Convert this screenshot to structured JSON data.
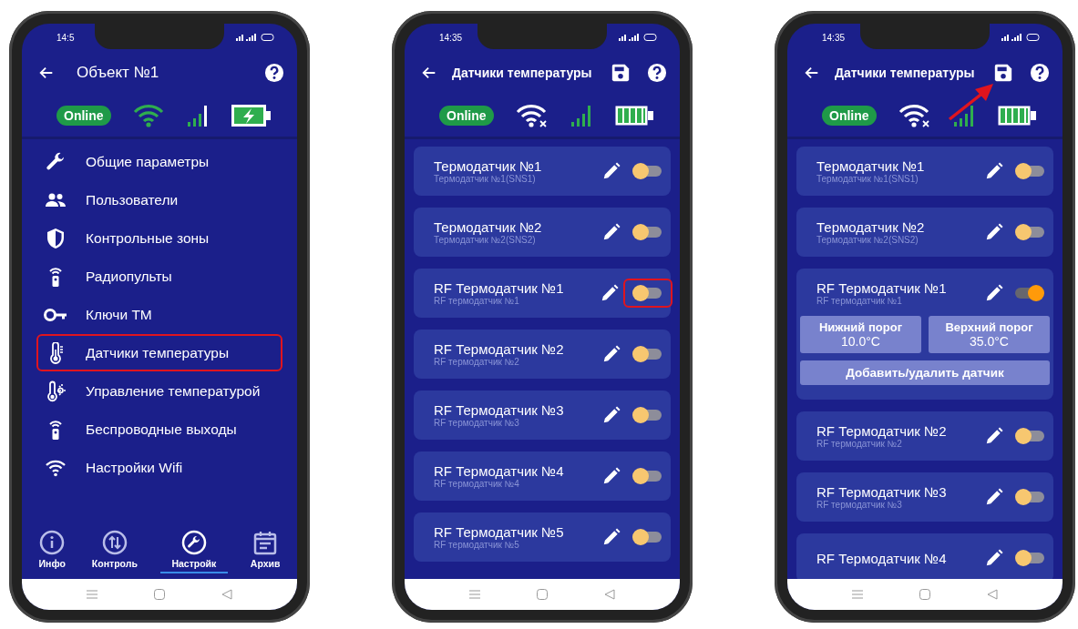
{
  "phones": [
    {
      "kind": "menu",
      "status_bar": {
        "time": "14:5"
      },
      "app_bar": {
        "title": "Объект №1",
        "actions": [
          {
            "kind": "help"
          }
        ]
      },
      "connection": {
        "badge": "Online",
        "indicators": [
          {
            "kind": "wifi"
          },
          {
            "kind": "signal"
          },
          {
            "kind": "charging"
          }
        ]
      },
      "menu": [
        {
          "label": "Общие параметры",
          "kind": "wrench",
          "highlighted": false
        },
        {
          "label": "Пользователи",
          "kind": "people",
          "highlighted": false
        },
        {
          "label": "Контрольные зоны",
          "kind": "shield",
          "highlighted": false
        },
        {
          "label": "Радиопульты",
          "kind": "remote",
          "highlighted": false
        },
        {
          "label": "Ключи ТМ",
          "kind": "key",
          "highlighted": false
        },
        {
          "label": "Датчики температуры",
          "kind": "thermometer",
          "highlighted": true
        },
        {
          "label": "Управление температурой",
          "kind": "thermosun",
          "highlighted": false
        },
        {
          "label": "Беспроводные выходы",
          "kind": "remote",
          "highlighted": false
        },
        {
          "label": "Настройки Wifi",
          "kind": "wifi",
          "highlighted": false
        }
      ],
      "bottom_nav": [
        {
          "label": "Инфо",
          "kind": "info",
          "selected": false
        },
        {
          "label": "Контроль",
          "kind": "arrows",
          "selected": false
        },
        {
          "label": "Настройк",
          "kind": "wrench",
          "selected": true
        },
        {
          "label": "Архив",
          "kind": "calendar",
          "selected": false
        }
      ]
    },
    {
      "kind": "sensors",
      "status_bar": {
        "time": "14:35"
      },
      "app_bar": {
        "title": "Датчики температуры",
        "actions": [
          {
            "kind": "save"
          },
          {
            "kind": "help"
          }
        ]
      },
      "connection": {
        "badge": "Online",
        "indicators": [
          {
            "kind": "wifi_off"
          },
          {
            "kind": "signal"
          },
          {
            "kind": "full"
          }
        ]
      },
      "sensors": [
        {
          "title": "Термодатчик №1",
          "subtitle": "Термодатчик №1(SNS1)",
          "on": false,
          "highlighted": false,
          "expanded": false
        },
        {
          "title": "Термодатчик №2",
          "subtitle": "Термодатчик №2(SNS2)",
          "on": false,
          "highlighted": false,
          "expanded": false
        },
        {
          "title": "RF Термодатчик №1",
          "subtitle": "RF термодатчик №1",
          "on": false,
          "highlighted": true,
          "expanded": false
        },
        {
          "title": "RF Термодатчик №2",
          "subtitle": "RF термодатчик №2",
          "on": false,
          "highlighted": false,
          "expanded": false
        },
        {
          "title": "RF Термодатчик №3",
          "subtitle": "RF термодатчик №3",
          "on": false,
          "highlighted": false,
          "expanded": false
        },
        {
          "title": "RF Термодатчик №4",
          "subtitle": "RF термодатчик №4",
          "on": false,
          "highlighted": false,
          "expanded": false
        },
        {
          "title": "RF Термодатчик №5",
          "subtitle": "RF термодатчик №5",
          "on": false,
          "highlighted": false,
          "expanded": false
        }
      ]
    },
    {
      "kind": "sensors",
      "status_bar": {
        "time": "14:35"
      },
      "app_bar": {
        "title": "Датчики температуры",
        "actions": [
          {
            "kind": "save"
          },
          {
            "kind": "help"
          }
        ],
        "arrow_to_save": true
      },
      "connection": {
        "badge": "Online",
        "indicators": [
          {
            "kind": "wifi_off"
          },
          {
            "kind": "signal"
          },
          {
            "kind": "full"
          }
        ]
      },
      "sensors": [
        {
          "title": "Термодатчик №1",
          "subtitle": "Термодатчик №1(SNS1)",
          "on": false,
          "highlighted": false,
          "expanded": false
        },
        {
          "title": "Термодатчик №2",
          "subtitle": "Термодатчик №2(SNS2)",
          "on": false,
          "highlighted": false,
          "expanded": false
        },
        {
          "title": "RF Термодатчик №1",
          "subtitle": "RF термодатчик №1",
          "on": true,
          "highlighted": false,
          "expanded": true,
          "thresholds": [
            {
              "label": "Нижний порог",
              "value": "10.0°C"
            },
            {
              "label": "Верхний порог",
              "value": "35.0°C"
            }
          ],
          "action": "Добавить/удалить датчик"
        },
        {
          "title": "RF Термодатчик №2",
          "subtitle": "RF термодатчик №2",
          "on": false,
          "highlighted": false,
          "expanded": false
        },
        {
          "title": "RF Термодатчик №3",
          "subtitle": "RF термодатчик №3",
          "on": false,
          "highlighted": false,
          "expanded": false
        },
        {
          "title": "RF Термодатчик №4",
          "on": false,
          "highlighted": false,
          "expanded": false
        }
      ]
    }
  ]
}
